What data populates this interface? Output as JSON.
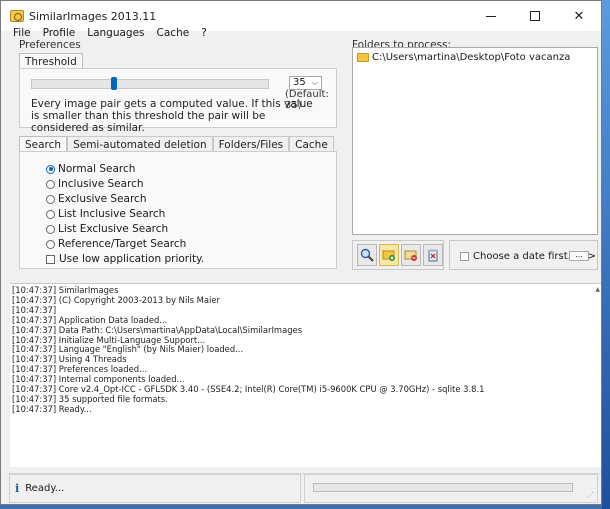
{
  "window": {
    "title": "SimilarImages 2013.11"
  },
  "menu": [
    "File",
    "Profile",
    "Languages",
    "Cache",
    "?"
  ],
  "preferences": {
    "label": "Preferences",
    "threshold_tab": "Threshold",
    "threshold_value": "35",
    "threshold_default": "(Default: 35)",
    "slider_fraction": 0.35,
    "description": "Every image pair gets a computed value. If this value is smaller than this threshold the pair will be considered as similar."
  },
  "search_tabs": [
    "Search",
    "Semi-automated deletion",
    "Folders/Files",
    "Cache"
  ],
  "search_options": [
    {
      "label": "Normal Search",
      "checked": true
    },
    {
      "label": "Inclusive Search",
      "checked": false
    },
    {
      "label": "Exclusive Search",
      "checked": false
    },
    {
      "label": "List Inclusive Search",
      "checked": false
    },
    {
      "label": "List Exclusive Search",
      "checked": false
    },
    {
      "label": "Reference/Target Search",
      "checked": false
    }
  ],
  "low_priority_label": "Use low application priority.",
  "folders": {
    "label": "Folders to process:",
    "items": [
      "C:\\Users\\martina\\Desktop\\Foto vacanza"
    ]
  },
  "date_filter": {
    "label": "Choose a date first... -->",
    "button": "..."
  },
  "log": [
    "[10:47:37] SimilarImages",
    "[10:47:37] (C) Copyright 2003-2013 by Nils Maier",
    "[10:47:37]",
    "[10:47:37] Application Data loaded...",
    "[10:47:37] Data Path: C:\\Users\\martina\\AppData\\Local\\SimilarImages",
    "[10:47:37] Initialize Multi-Language Support...",
    "[10:47:37] Language \"English\" (by Nils Maier) loaded...",
    "[10:47:37] Using 4 Threads",
    "[10:47:37] Preferences loaded...",
    "[10:47:37] Internal components loaded...",
    "[10:47:37] Core v2.4_Opt-ICC - GFLSDK 3.40 - (SSE4.2; Intel(R) Core(TM) i5-9600K CPU @ 3.70GHz) - sqlite 3.8.1",
    "[10:47:37] 35 supported file formats.",
    "[10:47:37] Ready..."
  ],
  "status": {
    "text": "Ready...",
    "progress": 0
  },
  "colors": {
    "accent": "#0067c0",
    "desktop": "#3b6fb0"
  }
}
